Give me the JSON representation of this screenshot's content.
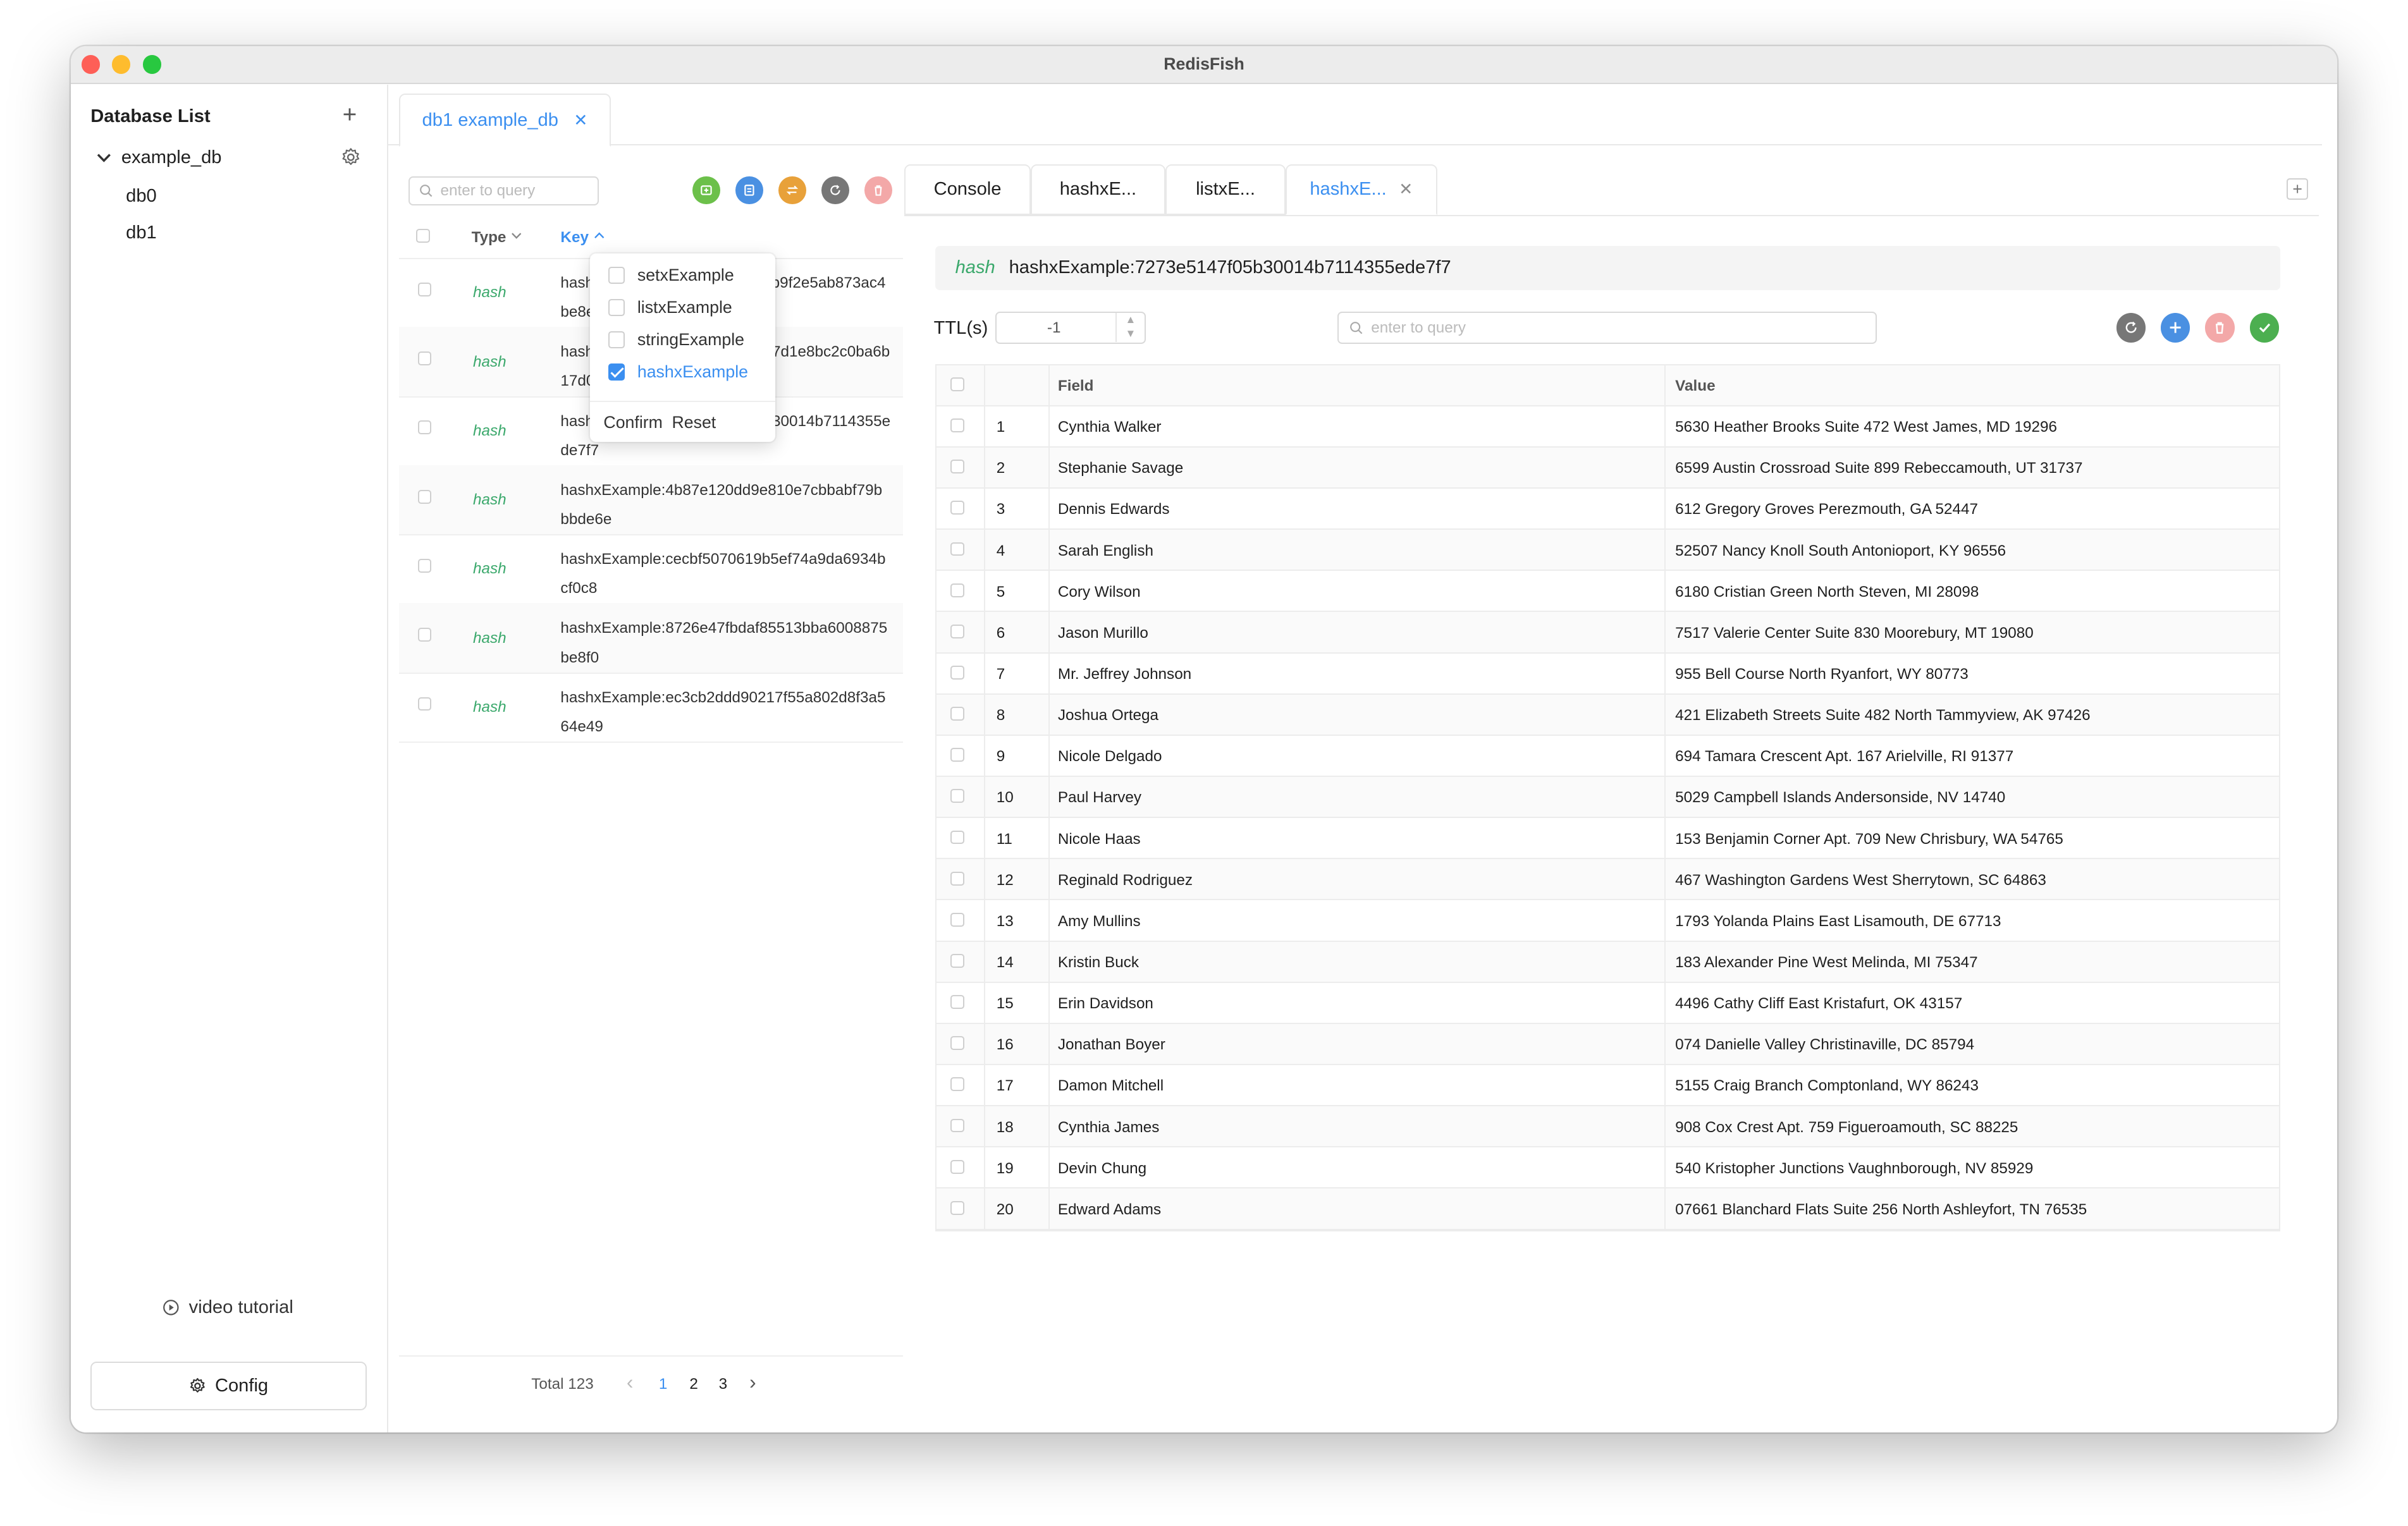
{
  "app": {
    "title": "RedisFish"
  },
  "sidebar": {
    "title": "Database List",
    "database": "example_db",
    "dbs": [
      "db0",
      "db1"
    ],
    "video_label": "video tutorial",
    "config_label": "Config"
  },
  "top_tab": {
    "label": "db1 example_db"
  },
  "key_list": {
    "search_placeholder": "enter to query",
    "col_type": "Type",
    "col_key": "Key",
    "rows": [
      {
        "type": "hash",
        "key": "hashxExample:e4f1c6de0d3a7b9f2e5ab873ac4be8eee806"
      },
      {
        "type": "hash",
        "key": "hashxExample:9a1f05d3b86e47d1e8bc2c0ba6b17d0673c"
      },
      {
        "type": "hash",
        "key": "hashxExample:7273e5147f05b30014b7114355ede7f7"
      },
      {
        "type": "hash",
        "key": "hashxExample:4b87e120dd9e810e7cbbabf79bbbde6e"
      },
      {
        "type": "hash",
        "key": "hashxExample:cecbf5070619b5ef74a9da6934bcf0c8"
      },
      {
        "type": "hash",
        "key": "hashxExample:8726e47fbdaf85513bba6008875be8f0"
      },
      {
        "type": "hash",
        "key": "hashxExample:ec3cb2ddd90217f55a802d8f3a564e49"
      }
    ],
    "total_label": "Total 123",
    "pages": [
      "1",
      "2",
      "3"
    ],
    "prev": "‹",
    "next": "›"
  },
  "type_filter": {
    "options": [
      "setxExample",
      "listxExample",
      "stringExample",
      "hashxExample"
    ],
    "checked": "hashxExample",
    "confirm": "Confirm",
    "reset": "Reset"
  },
  "right_tabs": [
    "Console",
    "hashxE...",
    "listxE...",
    "hashxE..."
  ],
  "detail": {
    "type": "hash",
    "key": "hashxExample:7273e5147f05b30014b7114355ede7f7",
    "ttl_label": "TTL(s)",
    "ttl_value": "-1",
    "search_placeholder": "enter to query",
    "col_field": "Field",
    "col_value": "Value",
    "rows": [
      {
        "n": "1",
        "field": "Cynthia Walker",
        "value": "5630 Heather Brooks Suite 472 West James, MD 19296"
      },
      {
        "n": "2",
        "field": "Stephanie Savage",
        "value": "6599 Austin Crossroad Suite 899 Rebeccamouth, UT 31737"
      },
      {
        "n": "3",
        "field": "Dennis Edwards",
        "value": "612 Gregory Groves Perezmouth, GA 52447"
      },
      {
        "n": "4",
        "field": "Sarah English",
        "value": "52507 Nancy Knoll South Antonioport, KY 96556"
      },
      {
        "n": "5",
        "field": "Cory Wilson",
        "value": "6180 Cristian Green North Steven, MI 28098"
      },
      {
        "n": "6",
        "field": "Jason Murillo",
        "value": "7517 Valerie Center Suite 830 Moorebury, MT 19080"
      },
      {
        "n": "7",
        "field": "Mr. Jeffrey Johnson",
        "value": "955 Bell Course North Ryanfort, WY 80773"
      },
      {
        "n": "8",
        "field": "Joshua Ortega",
        "value": "421 Elizabeth Streets Suite 482 North Tammyview, AK 97426"
      },
      {
        "n": "9",
        "field": "Nicole Delgado",
        "value": "694 Tamara Crescent Apt. 167 Arielville, RI 91377"
      },
      {
        "n": "10",
        "field": "Paul Harvey",
        "value": "5029 Campbell Islands Andersonside, NV 14740"
      },
      {
        "n": "11",
        "field": "Nicole Haas",
        "value": "153 Benjamin Corner Apt. 709 New Chrisbury, WA 54765"
      },
      {
        "n": "12",
        "field": "Reginald Rodriguez",
        "value": "467 Washington Gardens West Sherrytown, SC 64863"
      },
      {
        "n": "13",
        "field": "Amy Mullins",
        "value": "1793 Yolanda Plains East Lisamouth, DE 67713"
      },
      {
        "n": "14",
        "field": "Kristin Buck",
        "value": "183 Alexander Pine West Melinda, MI 75347"
      },
      {
        "n": "15",
        "field": "Erin Davidson",
        "value": "4496 Cathy Cliff East Kristafurt, OK 43157"
      },
      {
        "n": "16",
        "field": "Jonathan Boyer",
        "value": "074 Danielle Valley Christinaville, DC 85794"
      },
      {
        "n": "17",
        "field": "Damon Mitchell",
        "value": "5155 Craig Branch Comptonland, WY 86243"
      },
      {
        "n": "18",
        "field": "Cynthia James",
        "value": "908 Cox Crest Apt. 759 Figueroamouth, SC 88225"
      },
      {
        "n": "19",
        "field": "Devin Chung",
        "value": "540 Kristopher Junctions Vaughnborough, NV 85929"
      },
      {
        "n": "20",
        "field": "Edward Adams",
        "value": "07661 Blanchard Flats Suite 256 North Ashleyfort, TN 76535"
      }
    ]
  },
  "colors": {
    "accent": "#3b8ff0",
    "type_green": "#3aa86b",
    "btn_green": "#6cc04a",
    "btn_blue": "#4a90e2",
    "btn_orange": "#e8a13a",
    "btn_gray": "#777777",
    "btn_red_disabled": "#f3a8a8",
    "btn_check_green": "#4caf50"
  }
}
